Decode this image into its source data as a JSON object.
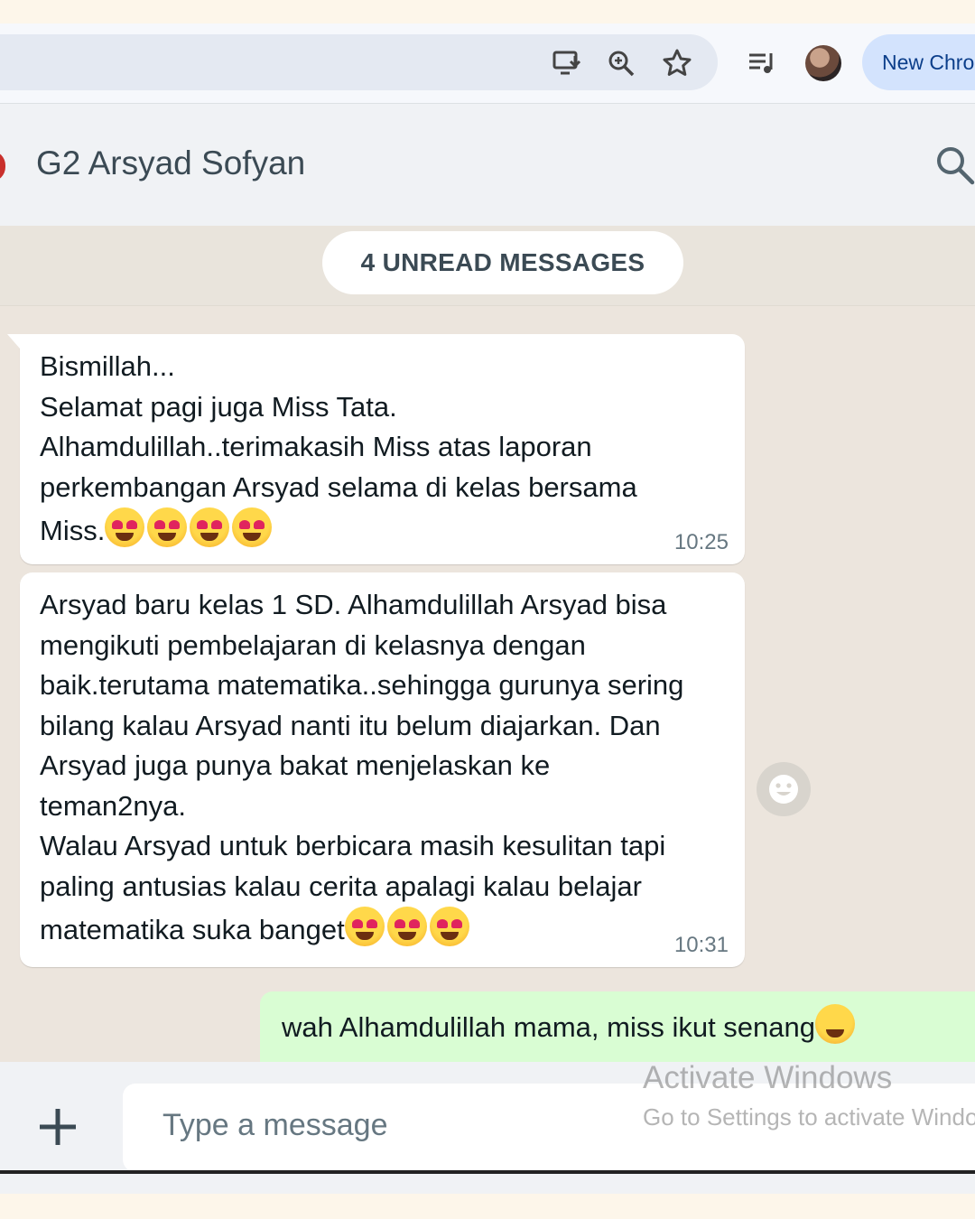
{
  "browser": {
    "new_chrome_label": "New Chrome available"
  },
  "header": {
    "title": "G2 Arsyad Sofyan"
  },
  "chat": {
    "unread_label": "4 UNREAD MESSAGES",
    "messages": [
      {
        "direction": "in",
        "lines": [
          "Bismillah...",
          "Selamat pagi juga Miss Tata.",
          "Alhamdulillah..terimakasih Miss atas laporan",
          "perkembangan Arsyad selama di kelas bersama",
          "Miss."
        ],
        "emojis": [
          "smiling-face-with-hearts",
          "smiling-face-with-hearts",
          "heart-eyes",
          "heart-eyes"
        ],
        "time": "10:25"
      },
      {
        "direction": "in",
        "lines": [
          "Arsyad baru kelas 1 SD. Alhamdulillah Arsyad bisa",
          "mengikuti pembelajaran di kelasnya dengan",
          "baik.terutama matematika..sehingga gurunya sering",
          "bilang kalau Arsyad nanti itu belum diajarkan. Dan",
          "Arsyad juga punya bakat menjelaskan ke",
          "teman2nya.",
          "Walau Arsyad untuk berbicara masih kesulitan tapi",
          "paling antusias kalau cerita apalagi kalau belajar",
          "matematika suka banget"
        ],
        "emojis": [
          "heart-eyes",
          "heart-eyes",
          "heart-eyes"
        ],
        "time": "10:31"
      },
      {
        "direction": "out",
        "text": "wah Alhamdulillah mama, miss ikut senang",
        "emojis": [
          "hugging-face"
        ]
      }
    ]
  },
  "footer": {
    "input_placeholder": "Type a message"
  },
  "watermark": {
    "title": "Activate Windows",
    "subtitle": "Go to Settings to activate Windows."
  },
  "colors": {
    "chat_bg": "#ece5dd",
    "incoming_bubble": "#ffffff",
    "outgoing_bubble": "#d9fdd3",
    "header_bg": "#f0f2f5"
  }
}
